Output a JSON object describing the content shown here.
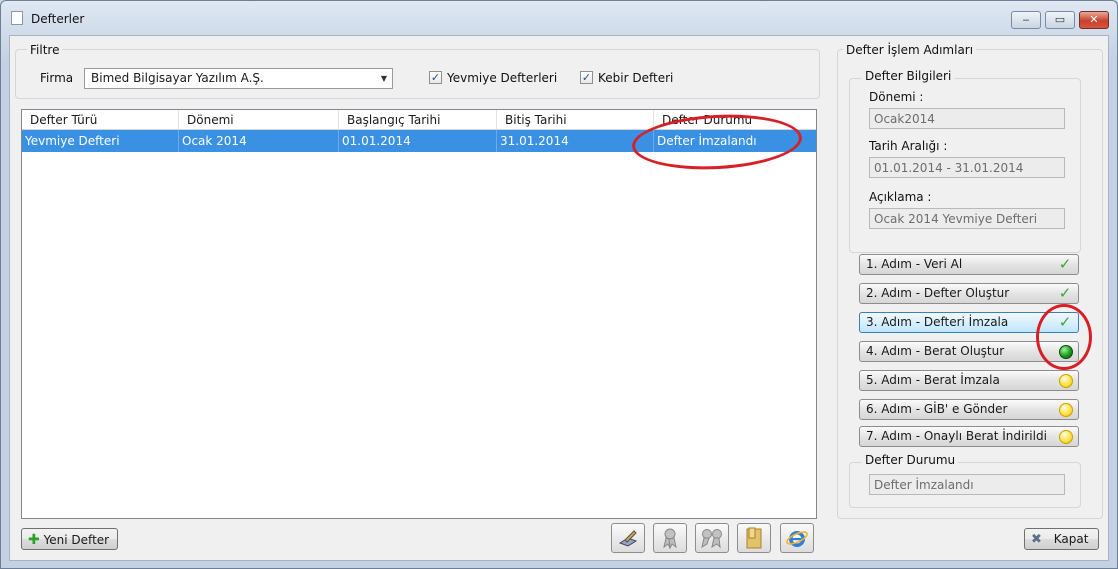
{
  "window": {
    "title": "Defterler"
  },
  "filter": {
    "group_label": "Filtre",
    "firma_label": "Firma",
    "firma_value": "Bimed Bilgisayar Yazılım A.Ş.",
    "yevmiye": {
      "label": "Yevmiye Defterleri",
      "checked": true
    },
    "kebir": {
      "label": "Kebir Defteri",
      "checked": true
    }
  },
  "grid": {
    "columns": [
      "Defter Türü",
      "Dönemi",
      "Başlangıç Tarihi",
      "Bitiş Tarihi",
      "Defter Durumu"
    ],
    "rows": [
      [
        "Yevmiye Defteri",
        "Ocak 2014",
        "01.01.2014",
        "31.01.2014",
        "Defter İmzalandı"
      ]
    ]
  },
  "steps_panel": {
    "group_label": "Defter İşlem Adımları",
    "info": {
      "group_label": "Defter Bilgileri",
      "donemi_label": "Dönemi :",
      "donemi_value": "Ocak2014",
      "tarih_label": "Tarih Aralığı :",
      "tarih_value": "01.01.2014 - 31.01.2014",
      "aciklama_label": "Açıklama :",
      "aciklama_value": "Ocak 2014 Yevmiye Defteri"
    },
    "steps": [
      {
        "label": "1. Adım - Veri Al",
        "status": "check"
      },
      {
        "label": "2. Adım - Defter Oluştur",
        "status": "check"
      },
      {
        "label": "3. Adım - Defteri İmzala",
        "status": "check"
      },
      {
        "label": "4. Adım - Berat Oluştur",
        "status": "green"
      },
      {
        "label": "5. Adım - Berat İmzala",
        "status": "yellow"
      },
      {
        "label": "6. Adım - GİB' e Gönder",
        "status": "yellow"
      },
      {
        "label": "7. Adım - Onaylı Berat İndirildi",
        "status": "yellow"
      }
    ],
    "status": {
      "group_label": "Defter Durumu",
      "value": "Defter İmzalandı"
    }
  },
  "footer": {
    "new_button": "Yeni Defter",
    "close_button": "Kapat"
  },
  "colors": {
    "selection": "#3a91e4",
    "annotation_red": "#d91f26"
  }
}
